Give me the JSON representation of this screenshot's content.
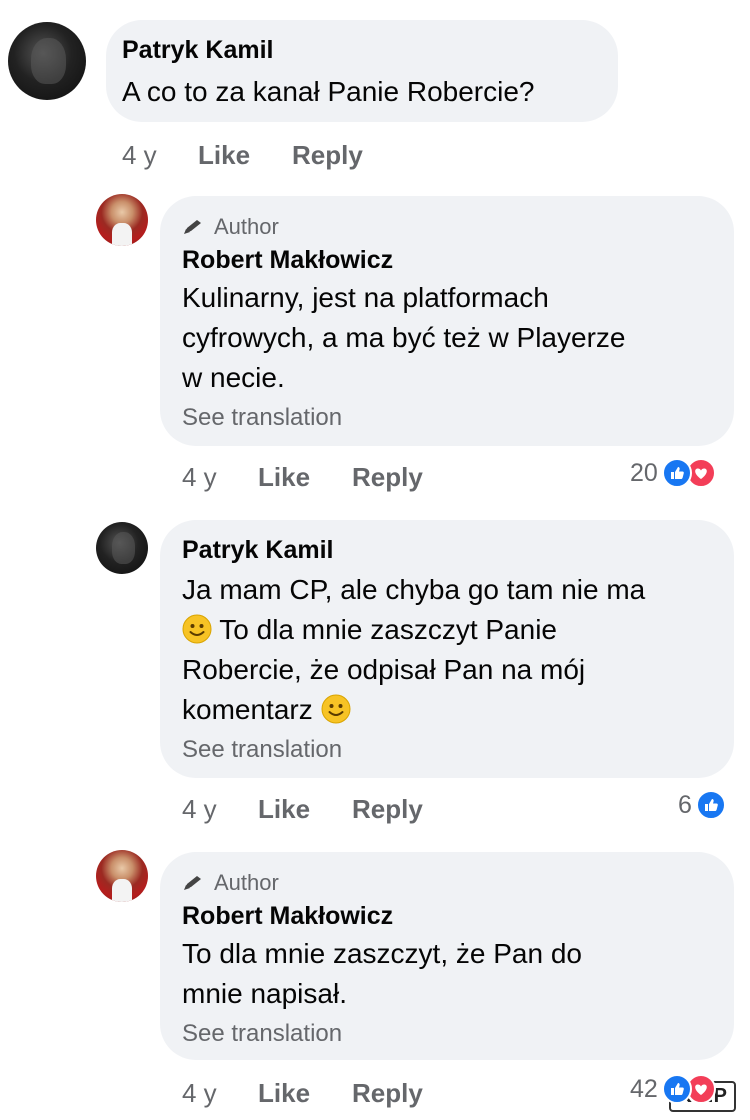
{
  "comments": [
    {
      "author": "Patryk Kamil",
      "text": "A co to za kanał Panie Robercie?",
      "age": "4 y",
      "like": "Like",
      "reply": "Reply"
    },
    {
      "badge": "Author",
      "author": "Robert Makłowicz",
      "lines": [
        "Kulinarny, jest na platformach",
        "cyfrowych, a ma być też w Playerze",
        "w necie."
      ],
      "see_translation": "See translation",
      "age": "4 y",
      "like": "Like",
      "reply": "Reply",
      "reactions": "20"
    },
    {
      "author": "Patryk Kamil",
      "line1": "Ja mam CP, ale chyba go tam nie ma",
      "line2": "To dla mnie zaszczyt Panie",
      "line3": "Robercie, że odpisał Pan na mój",
      "line4": "komentarz",
      "see_translation": "See translation",
      "age": "4 y",
      "like": "Like",
      "reply": "Reply",
      "reactions": "6"
    },
    {
      "badge": "Author",
      "author": "Robert Makłowicz",
      "lines": [
        "To dla mnie zaszczyt, że Pan do",
        "mnie napisał."
      ],
      "see_translation": "See translation",
      "age": "4 y",
      "like": "Like",
      "reply": "Reply",
      "reactions": "42"
    }
  ],
  "icons": {
    "like": "thumbs-up-icon",
    "love": "heart-icon",
    "author_badge": "pencil-icon",
    "emoji": "slightly-smiling-face-emoji"
  },
  "colors": {
    "bubble": "#f0f2f5",
    "like_blue": "#1877f2",
    "love_red": "#f33e58",
    "secondary_text": "#65676b"
  },
  "watermark": "KIEP"
}
